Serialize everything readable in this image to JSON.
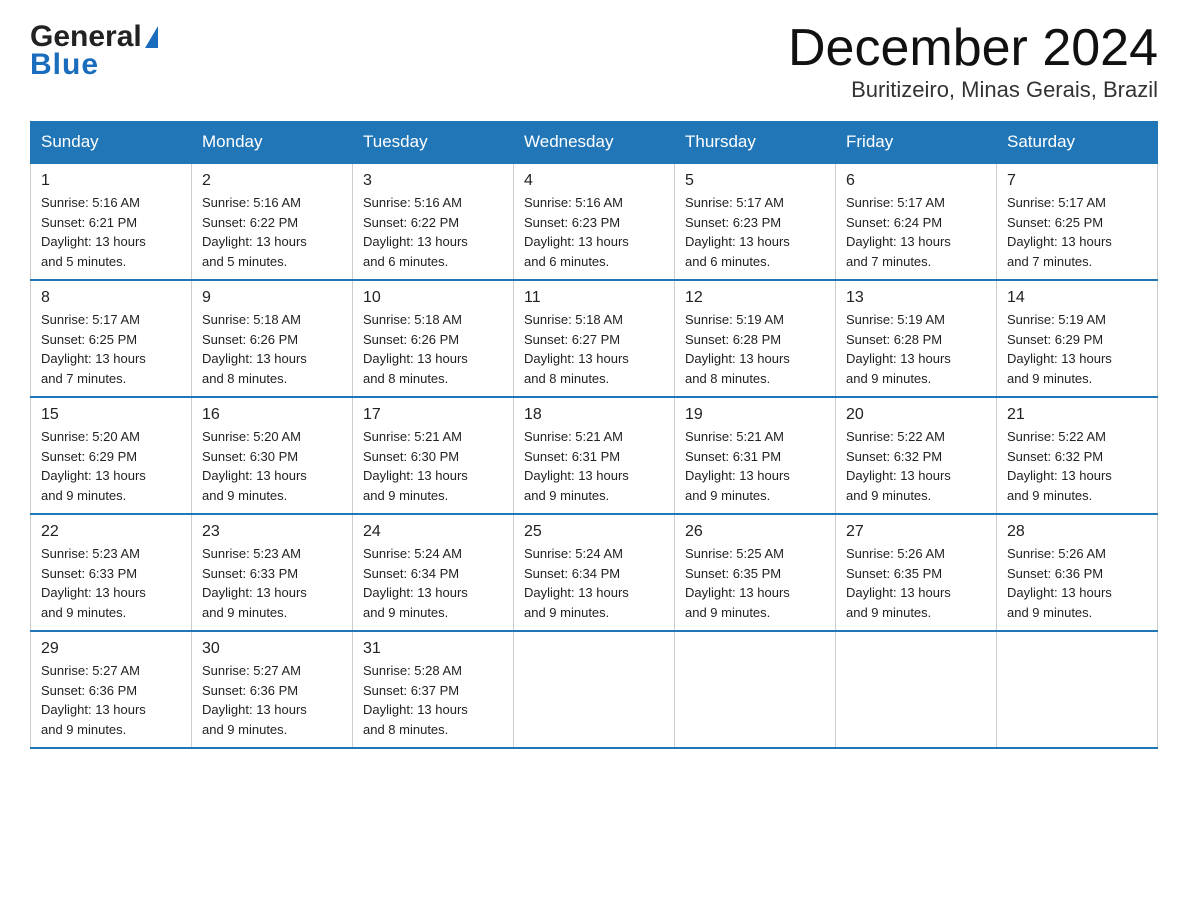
{
  "logo": {
    "general": "General",
    "blue": "Blue",
    "triangle": "▶"
  },
  "title": "December 2024",
  "location": "Buritizeiro, Minas Gerais, Brazil",
  "headers": [
    "Sunday",
    "Monday",
    "Tuesday",
    "Wednesday",
    "Thursday",
    "Friday",
    "Saturday"
  ],
  "weeks": [
    [
      {
        "day": "1",
        "sunrise": "5:16 AM",
        "sunset": "6:21 PM",
        "daylight": "13 hours and 5 minutes."
      },
      {
        "day": "2",
        "sunrise": "5:16 AM",
        "sunset": "6:22 PM",
        "daylight": "13 hours and 5 minutes."
      },
      {
        "day": "3",
        "sunrise": "5:16 AM",
        "sunset": "6:22 PM",
        "daylight": "13 hours and 6 minutes."
      },
      {
        "day": "4",
        "sunrise": "5:16 AM",
        "sunset": "6:23 PM",
        "daylight": "13 hours and 6 minutes."
      },
      {
        "day": "5",
        "sunrise": "5:17 AM",
        "sunset": "6:23 PM",
        "daylight": "13 hours and 6 minutes."
      },
      {
        "day": "6",
        "sunrise": "5:17 AM",
        "sunset": "6:24 PM",
        "daylight": "13 hours and 7 minutes."
      },
      {
        "day": "7",
        "sunrise": "5:17 AM",
        "sunset": "6:25 PM",
        "daylight": "13 hours and 7 minutes."
      }
    ],
    [
      {
        "day": "8",
        "sunrise": "5:17 AM",
        "sunset": "6:25 PM",
        "daylight": "13 hours and 7 minutes."
      },
      {
        "day": "9",
        "sunrise": "5:18 AM",
        "sunset": "6:26 PM",
        "daylight": "13 hours and 8 minutes."
      },
      {
        "day": "10",
        "sunrise": "5:18 AM",
        "sunset": "6:26 PM",
        "daylight": "13 hours and 8 minutes."
      },
      {
        "day": "11",
        "sunrise": "5:18 AM",
        "sunset": "6:27 PM",
        "daylight": "13 hours and 8 minutes."
      },
      {
        "day": "12",
        "sunrise": "5:19 AM",
        "sunset": "6:28 PM",
        "daylight": "13 hours and 8 minutes."
      },
      {
        "day": "13",
        "sunrise": "5:19 AM",
        "sunset": "6:28 PM",
        "daylight": "13 hours and 9 minutes."
      },
      {
        "day": "14",
        "sunrise": "5:19 AM",
        "sunset": "6:29 PM",
        "daylight": "13 hours and 9 minutes."
      }
    ],
    [
      {
        "day": "15",
        "sunrise": "5:20 AM",
        "sunset": "6:29 PM",
        "daylight": "13 hours and 9 minutes."
      },
      {
        "day": "16",
        "sunrise": "5:20 AM",
        "sunset": "6:30 PM",
        "daylight": "13 hours and 9 minutes."
      },
      {
        "day": "17",
        "sunrise": "5:21 AM",
        "sunset": "6:30 PM",
        "daylight": "13 hours and 9 minutes."
      },
      {
        "day": "18",
        "sunrise": "5:21 AM",
        "sunset": "6:31 PM",
        "daylight": "13 hours and 9 minutes."
      },
      {
        "day": "19",
        "sunrise": "5:21 AM",
        "sunset": "6:31 PM",
        "daylight": "13 hours and 9 minutes."
      },
      {
        "day": "20",
        "sunrise": "5:22 AM",
        "sunset": "6:32 PM",
        "daylight": "13 hours and 9 minutes."
      },
      {
        "day": "21",
        "sunrise": "5:22 AM",
        "sunset": "6:32 PM",
        "daylight": "13 hours and 9 minutes."
      }
    ],
    [
      {
        "day": "22",
        "sunrise": "5:23 AM",
        "sunset": "6:33 PM",
        "daylight": "13 hours and 9 minutes."
      },
      {
        "day": "23",
        "sunrise": "5:23 AM",
        "sunset": "6:33 PM",
        "daylight": "13 hours and 9 minutes."
      },
      {
        "day": "24",
        "sunrise": "5:24 AM",
        "sunset": "6:34 PM",
        "daylight": "13 hours and 9 minutes."
      },
      {
        "day": "25",
        "sunrise": "5:24 AM",
        "sunset": "6:34 PM",
        "daylight": "13 hours and 9 minutes."
      },
      {
        "day": "26",
        "sunrise": "5:25 AM",
        "sunset": "6:35 PM",
        "daylight": "13 hours and 9 minutes."
      },
      {
        "day": "27",
        "sunrise": "5:26 AM",
        "sunset": "6:35 PM",
        "daylight": "13 hours and 9 minutes."
      },
      {
        "day": "28",
        "sunrise": "5:26 AM",
        "sunset": "6:36 PM",
        "daylight": "13 hours and 9 minutes."
      }
    ],
    [
      {
        "day": "29",
        "sunrise": "5:27 AM",
        "sunset": "6:36 PM",
        "daylight": "13 hours and 9 minutes."
      },
      {
        "day": "30",
        "sunrise": "5:27 AM",
        "sunset": "6:36 PM",
        "daylight": "13 hours and 9 minutes."
      },
      {
        "day": "31",
        "sunrise": "5:28 AM",
        "sunset": "6:37 PM",
        "daylight": "13 hours and 8 minutes."
      },
      null,
      null,
      null,
      null
    ]
  ],
  "labels": {
    "sunrise": "Sunrise:",
    "sunset": "Sunset:",
    "daylight": "Daylight:"
  }
}
